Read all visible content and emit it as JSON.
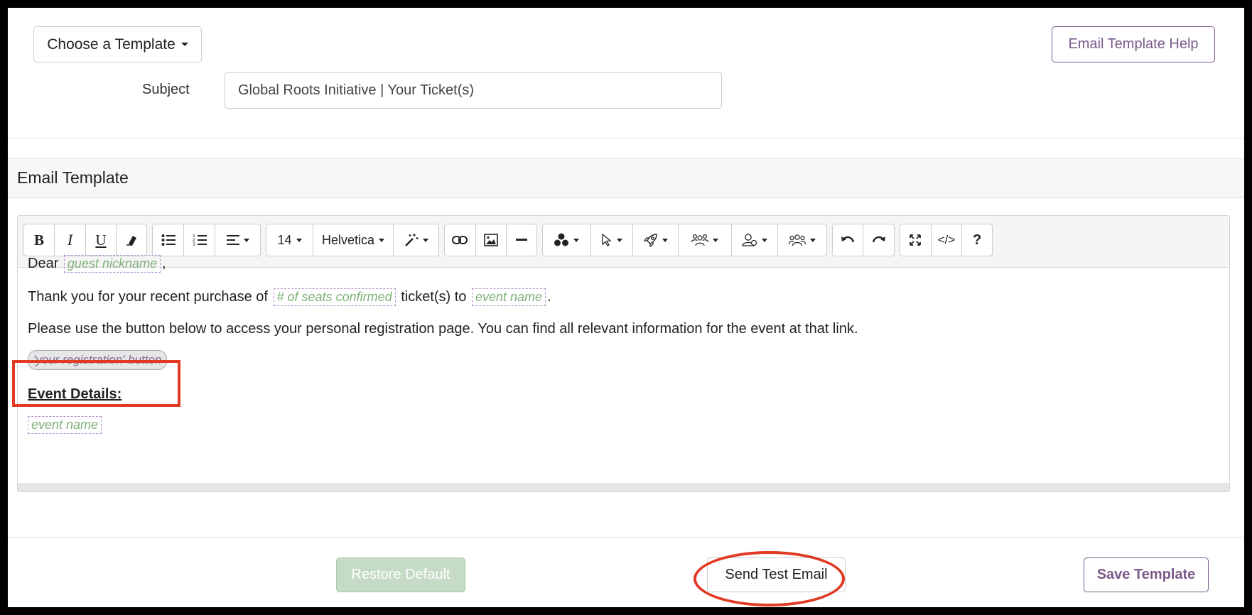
{
  "header": {
    "choose_template_label": "Choose a Template",
    "help_label": "Email Template Help"
  },
  "subject": {
    "label": "Subject",
    "value": "Global Roots Initiative | Your Ticket(s)"
  },
  "panel": {
    "title": "Email Template"
  },
  "toolbar": {
    "bold": "B",
    "italic": "I",
    "underline": "U",
    "font_size": "14",
    "font_family": "Helvetica",
    "code_view": "</>",
    "help": "?"
  },
  "content": {
    "dear": "Dear",
    "guest_nickname": "guest nickname",
    "comma": ",",
    "thank_you": "Thank you for your recent purchase of",
    "seats_confirmed": "# of seats confirmed",
    "tickets_to": "ticket(s) to",
    "event_name": "event name",
    "period": ".",
    "please_use": "Please use the button below to access your personal registration page. You can find all relevant information for the event at that link.",
    "registration_button": "'your registration' button",
    "event_details": "Event Details:",
    "event_name_2": "event name"
  },
  "footer": {
    "restore_label": "Restore Default",
    "send_test_label": "Send Test Email",
    "save_label": "Save Template"
  },
  "colors": {
    "accent": "#7b5a8a",
    "placeholder_text": "#7fb07a",
    "highlight": "#e03a22",
    "restore_bg": "#c5dbc5"
  }
}
